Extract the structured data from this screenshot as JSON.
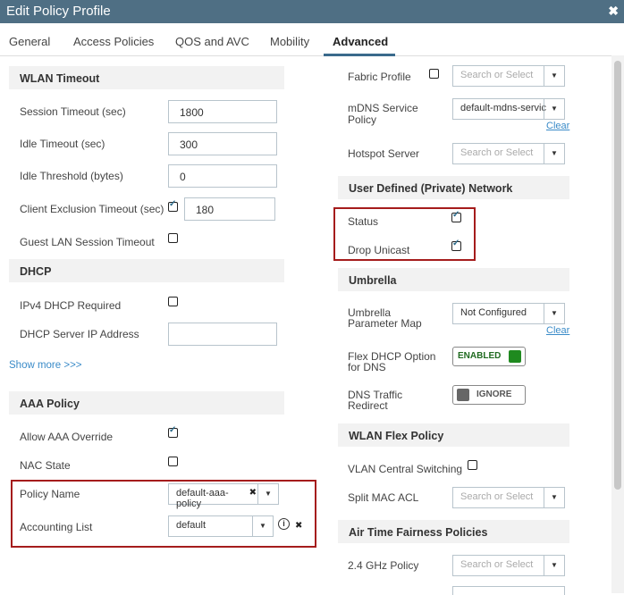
{
  "dialog": {
    "title": "Edit Policy Profile",
    "close_glyph": "✖"
  },
  "tabs": [
    {
      "label": "General"
    },
    {
      "label": "Access Policies"
    },
    {
      "label": "QOS and AVC"
    },
    {
      "label": "Mobility"
    },
    {
      "label": "Advanced"
    }
  ],
  "active_tab": "Advanced",
  "left": {
    "wlan_timeout": {
      "header": "WLAN Timeout",
      "session_timeout_label": "Session Timeout (sec)",
      "session_timeout_value": "1800",
      "idle_timeout_label": "Idle Timeout (sec)",
      "idle_timeout_value": "300",
      "idle_threshold_label": "Idle Threshold (bytes)",
      "idle_threshold_value": "0",
      "client_exclusion_label": "Client Exclusion Timeout (sec)",
      "client_exclusion_value": "180",
      "client_exclusion_checked": true,
      "guest_lan_label": "Guest LAN Session Timeout",
      "guest_lan_checked": false
    },
    "dhcp": {
      "header": "DHCP",
      "ipv4_required_label": "IPv4 DHCP Required",
      "ipv4_required_checked": false,
      "server_ip_label": "DHCP Server IP Address",
      "server_ip_value": ""
    },
    "show_more": "Show more >>>",
    "aaa": {
      "header": "AAA Policy",
      "allow_override_label": "Allow AAA Override",
      "allow_override_checked": true,
      "nac_state_label": "NAC State",
      "nac_state_checked": false,
      "policy_name_label": "Policy Name",
      "policy_name_value": "default-aaa-policy",
      "accounting_list_label": "Accounting List",
      "accounting_list_value": "default",
      "clear_glyph": "✖",
      "info_glyph": "i"
    }
  },
  "right": {
    "fabric_profile_label": "Fabric Profile",
    "fabric_profile_placeholder": "Search or Select",
    "mdns_label": "mDNS Service Policy",
    "mdns_value": "default-mdns-servic",
    "clear_label": "Clear",
    "hotspot_label": "Hotspot Server",
    "hotspot_placeholder": "Search or Select",
    "udn": {
      "header": "User Defined (Private) Network",
      "status_label": "Status",
      "status_checked": true,
      "drop_unicast_label": "Drop Unicast",
      "drop_unicast_checked": true
    },
    "umbrella": {
      "header": "Umbrella",
      "param_map_label": "Umbrella Parameter Map",
      "param_map_value": "Not Configured",
      "clear_label": "Clear",
      "flex_dhcp_label": "Flex DHCP Option for DNS",
      "flex_dhcp_state": "ENABLED",
      "dns_redirect_label": "DNS Traffic Redirect",
      "dns_redirect_state": "IGNORE"
    },
    "wlan_flex": {
      "header": "WLAN Flex Policy",
      "vlan_central_label": "VLAN Central Switching",
      "vlan_central_checked": false,
      "split_mac_label": "Split MAC ACL",
      "split_mac_placeholder": "Search or Select"
    },
    "atf": {
      "header": "Air Time Fairness Policies",
      "ghz24_label": "2.4 GHz Policy",
      "ghz24_placeholder": "Search or Select"
    }
  },
  "colors": {
    "titlebar": "#4f6f84",
    "highlight_box": "#a51c1c",
    "enabled_green": "#1f8a1f",
    "link": "#3a8bc8"
  }
}
